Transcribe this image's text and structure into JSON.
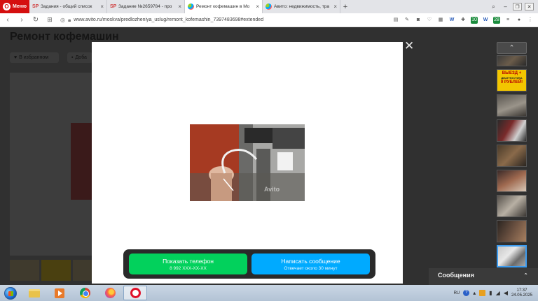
{
  "browser": {
    "menu_label": "Меню",
    "tabs": [
      {
        "label": "Задания - общий список",
        "active": false,
        "icon": "sp-icon"
      },
      {
        "label": "Задание №2659784 - про",
        "active": false,
        "icon": "sp-icon"
      },
      {
        "label": "Ремонт кофемашин в Мо",
        "active": true,
        "icon": "avito-icon"
      },
      {
        "label": "Авито: недвижимость, тра",
        "active": false,
        "icon": "avito-icon"
      }
    ],
    "url": "www.avito.ru/moskva/predlozheniya_uslug/remont_kofemashin_7397483698#extended",
    "ext_badges": {
      "green_count": "10",
      "g_count": "28"
    }
  },
  "page": {
    "title": "Ремонт кофемашин",
    "favorite_label": "В избранном",
    "add_label": "Доба"
  },
  "modal": {
    "watermark": "Avito",
    "show_phone": {
      "label": "Показать телефон",
      "sub": "8 992 XXX-XX-XX"
    },
    "write_message": {
      "label": "Написать сообщение",
      "sub": "Отвечает около 30 минут"
    }
  },
  "rail": {
    "ad_text": "ВЫЕЗД +",
    "ad_small": "ДИАГНОСТИКА",
    "ad_price": "0 РУБЛЕЙ!"
  },
  "messages_label": "Сообщения",
  "taskbar": {
    "lang": "RU",
    "time": "17:37",
    "date": "24.05.2025"
  }
}
